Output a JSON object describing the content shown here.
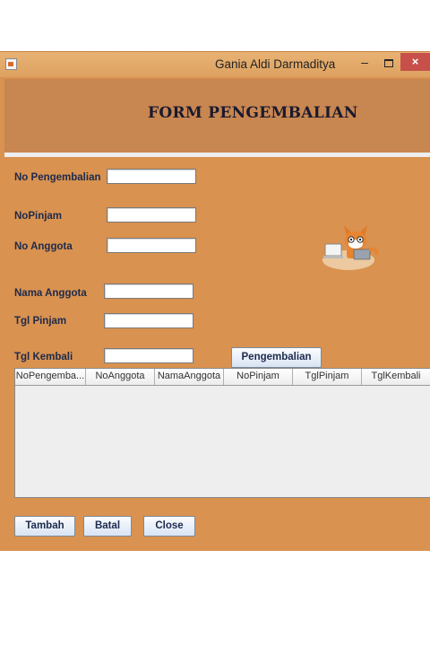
{
  "window": {
    "title": "Gania Aldi Darmaditya",
    "controls": {
      "minimize": "–",
      "close": "×"
    }
  },
  "form": {
    "heading": "FORM PENGEMBALIAN",
    "fields": [
      {
        "label": "No Pengembalian",
        "value": ""
      },
      {
        "label": "NoPinjam",
        "value": ""
      },
      {
        "label": "No Anggota",
        "value": ""
      },
      {
        "label": "Nama Anggota",
        "value": ""
      },
      {
        "label": "Tgl Pinjam",
        "value": ""
      },
      {
        "label": "Tgl Kembali",
        "value": ""
      }
    ],
    "pengembalian_button": "Pengembalian"
  },
  "table": {
    "columns": [
      "NoPengemba...",
      "NoAnggota",
      "NamaAnggota",
      "NoPinjam",
      "TglPinjam",
      "TglKembali"
    ],
    "rows": []
  },
  "actions": {
    "tambah": "Tambah",
    "batal": "Batal",
    "close": "Close"
  },
  "colors": {
    "panel": "#d9924f",
    "banner": "#c88651",
    "heading": "#1a1a2e"
  }
}
